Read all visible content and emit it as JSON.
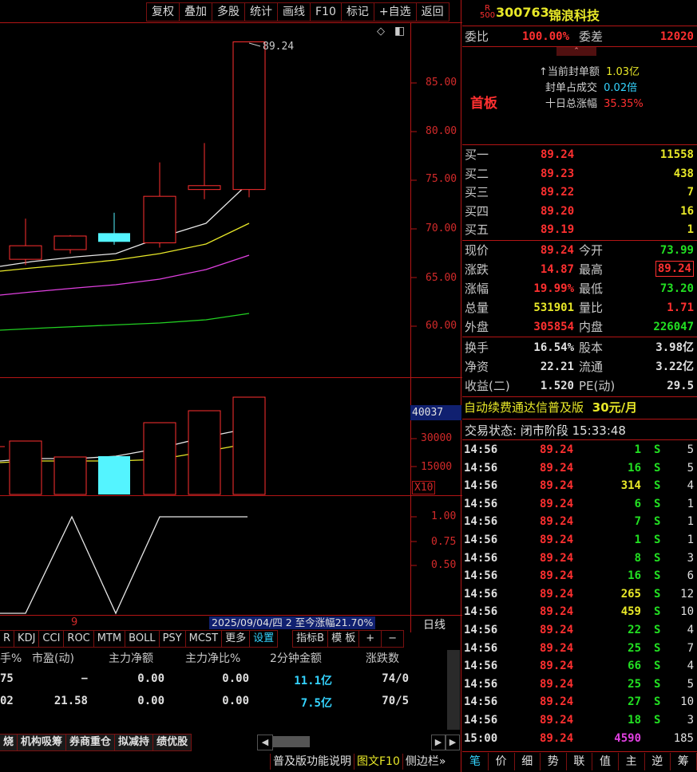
{
  "toolbar": {
    "items": [
      "复权",
      "叠加",
      "多股",
      "统计",
      "画线",
      "F10",
      "标记",
      "+自选",
      "返回"
    ]
  },
  "price_axis": [
    "85.00",
    "80.00",
    "75.00",
    "70.00",
    "65.00",
    "60.00"
  ],
  "high_label": "89.24",
  "vol_axis": [
    "40037",
    "30000",
    "15000",
    "X10"
  ],
  "ind_axis": [
    "1.00",
    "0.75",
    "0.50"
  ],
  "date_bar": {
    "left_num": "9",
    "label": "2025/09/04/四 2 至今涨幅21.70%",
    "period": "日线"
  },
  "indicator_tabs": [
    "R",
    "KDJ",
    "CCI",
    "ROC",
    "MTM",
    "BOLL",
    "PSY",
    "MCST",
    "更多",
    "设置",
    "指标B",
    "模 板",
    "+",
    "−"
  ],
  "table": {
    "headers": [
      "手%",
      "市盈(动)",
      "主力净额",
      "主力净比%",
      "2分钟金额",
      "涨跌数"
    ],
    "rows": [
      [
        "75",
        "−",
        "0.00",
        "0.00",
        "11.1亿",
        "74/0"
      ],
      [
        "02",
        "21.58",
        "0.00",
        "0.00",
        "7.5亿",
        "70/5"
      ]
    ]
  },
  "bottom_tabs": [
    "烧",
    "机构吸筹",
    "券商重仓",
    "拟减持",
    "绩优股"
  ],
  "bottom_bar": [
    "普及版功能说明",
    "图文F10",
    "侧边栏»"
  ],
  "stock": {
    "badge_top": "R",
    "badge_bot": "500",
    "code": "300763",
    "name": "锦浪科技"
  },
  "weibi": {
    "label": "委比",
    "value": "100.00%",
    "diff_label": "委差",
    "diff": "12020"
  },
  "limit": {
    "tag": "首板",
    "l1": "当前封单额",
    "v1": "1.03亿",
    "l2": "封单占成交",
    "v2": "0.02倍",
    "l3": "十日总涨幅",
    "v3": "35.35%"
  },
  "bids": [
    {
      "label": "买一",
      "price": "89.24",
      "vol": "11558"
    },
    {
      "label": "买二",
      "price": "89.23",
      "vol": "438"
    },
    {
      "label": "买三",
      "price": "89.22",
      "vol": "7"
    },
    {
      "label": "买四",
      "price": "89.20",
      "vol": "16"
    },
    {
      "label": "买五",
      "price": "89.19",
      "vol": "1"
    }
  ],
  "quote": [
    {
      "l": "现价",
      "v": "89.24",
      "l2": "今开",
      "v2": "73.99"
    },
    {
      "l": "涨跌",
      "v": "14.87",
      "l2": "最高",
      "v2": "89.24"
    },
    {
      "l": "涨幅",
      "v": "19.99%",
      "l2": "最低",
      "v2": "73.20"
    },
    {
      "l": "总量",
      "v": "531901",
      "l2": "量比",
      "v2": "1.71"
    },
    {
      "l": "外盘",
      "v": "305854",
      "l2": "内盘",
      "v2": "226047"
    }
  ],
  "fund": [
    {
      "l": "换手",
      "v": "16.54%",
      "l2": "股本",
      "v2": "3.98亿"
    },
    {
      "l": "净资",
      "v": "22.21",
      "l2": "流通",
      "v2": "3.22亿"
    },
    {
      "l": "收益(二)",
      "v": "1.520",
      "l2": "PE(动)",
      "v2": "29.5"
    }
  ],
  "ad": {
    "text": "自动续费通达信普及版",
    "price": "30元/月"
  },
  "trade_status": "交易状态: 闭市阶段 15:33:48",
  "ticks": [
    [
      "14:56",
      "89.24",
      "1",
      "S",
      "5"
    ],
    [
      "14:56",
      "89.24",
      "16",
      "S",
      "5"
    ],
    [
      "14:56",
      "89.24",
      "314",
      "S",
      "4"
    ],
    [
      "14:56",
      "89.24",
      "6",
      "S",
      "1"
    ],
    [
      "14:56",
      "89.24",
      "7",
      "S",
      "1"
    ],
    [
      "14:56",
      "89.24",
      "1",
      "S",
      "1"
    ],
    [
      "14:56",
      "89.24",
      "8",
      "S",
      "3"
    ],
    [
      "14:56",
      "89.24",
      "16",
      "S",
      "6"
    ],
    [
      "14:56",
      "89.24",
      "265",
      "S",
      "12"
    ],
    [
      "14:56",
      "89.24",
      "459",
      "S",
      "10"
    ],
    [
      "14:56",
      "89.24",
      "22",
      "S",
      "4"
    ],
    [
      "14:56",
      "89.24",
      "25",
      "S",
      "7"
    ],
    [
      "14:56",
      "89.24",
      "66",
      "S",
      "4"
    ],
    [
      "14:56",
      "89.24",
      "25",
      "S",
      "5"
    ],
    [
      "14:56",
      "89.24",
      "27",
      "S",
      "10"
    ],
    [
      "14:56",
      "89.24",
      "18",
      "S",
      "3"
    ],
    [
      "15:00",
      "89.24",
      "4590",
      "",
      "185"
    ]
  ],
  "right_tabs": [
    "笔",
    "价",
    "细",
    "势",
    "联",
    "值",
    "主",
    "逆",
    "筹"
  ],
  "colors": {
    "up": "#ff3030",
    "down": "#22e022",
    "border": "#b31515",
    "cyan": "#54f4ff"
  }
}
